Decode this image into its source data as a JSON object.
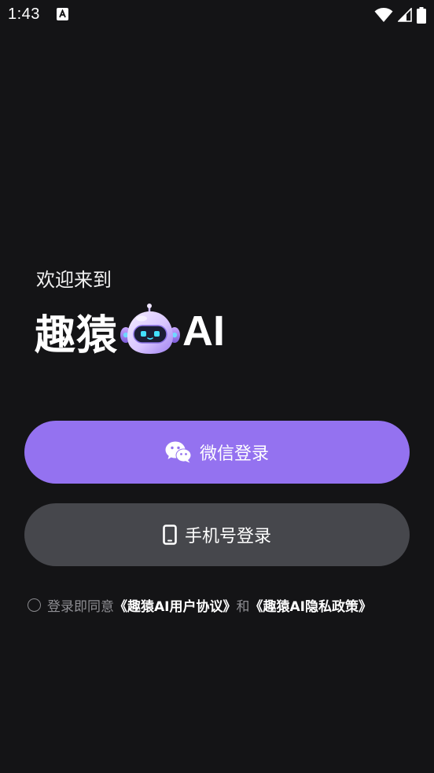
{
  "status_bar": {
    "time": "1:43"
  },
  "icons": {
    "notification": "font-notification-icon",
    "wifi": "wifi-icon",
    "signal": "signal-icon",
    "battery": "battery-icon",
    "wechat": "wechat-icon",
    "phone": "smartphone-icon",
    "mascot": "robot-mascot-icon"
  },
  "welcome": {
    "greeting": "欢迎来到",
    "brand_name": "趣猿",
    "brand_suffix": "AI"
  },
  "buttons": {
    "wechat_login": "微信登录",
    "phone_login": "手机号登录"
  },
  "agreement": {
    "prefix": "登录即同意",
    "user_agreement": "《趣猿AI用户协议》",
    "conjunction": "和",
    "privacy_policy": "《趣猿AI隐私政策》",
    "checked": false
  },
  "colors": {
    "background": "#141416",
    "primary_button": "#9472f0",
    "secondary_button": "#46474c",
    "muted_text": "#8e8e93"
  }
}
